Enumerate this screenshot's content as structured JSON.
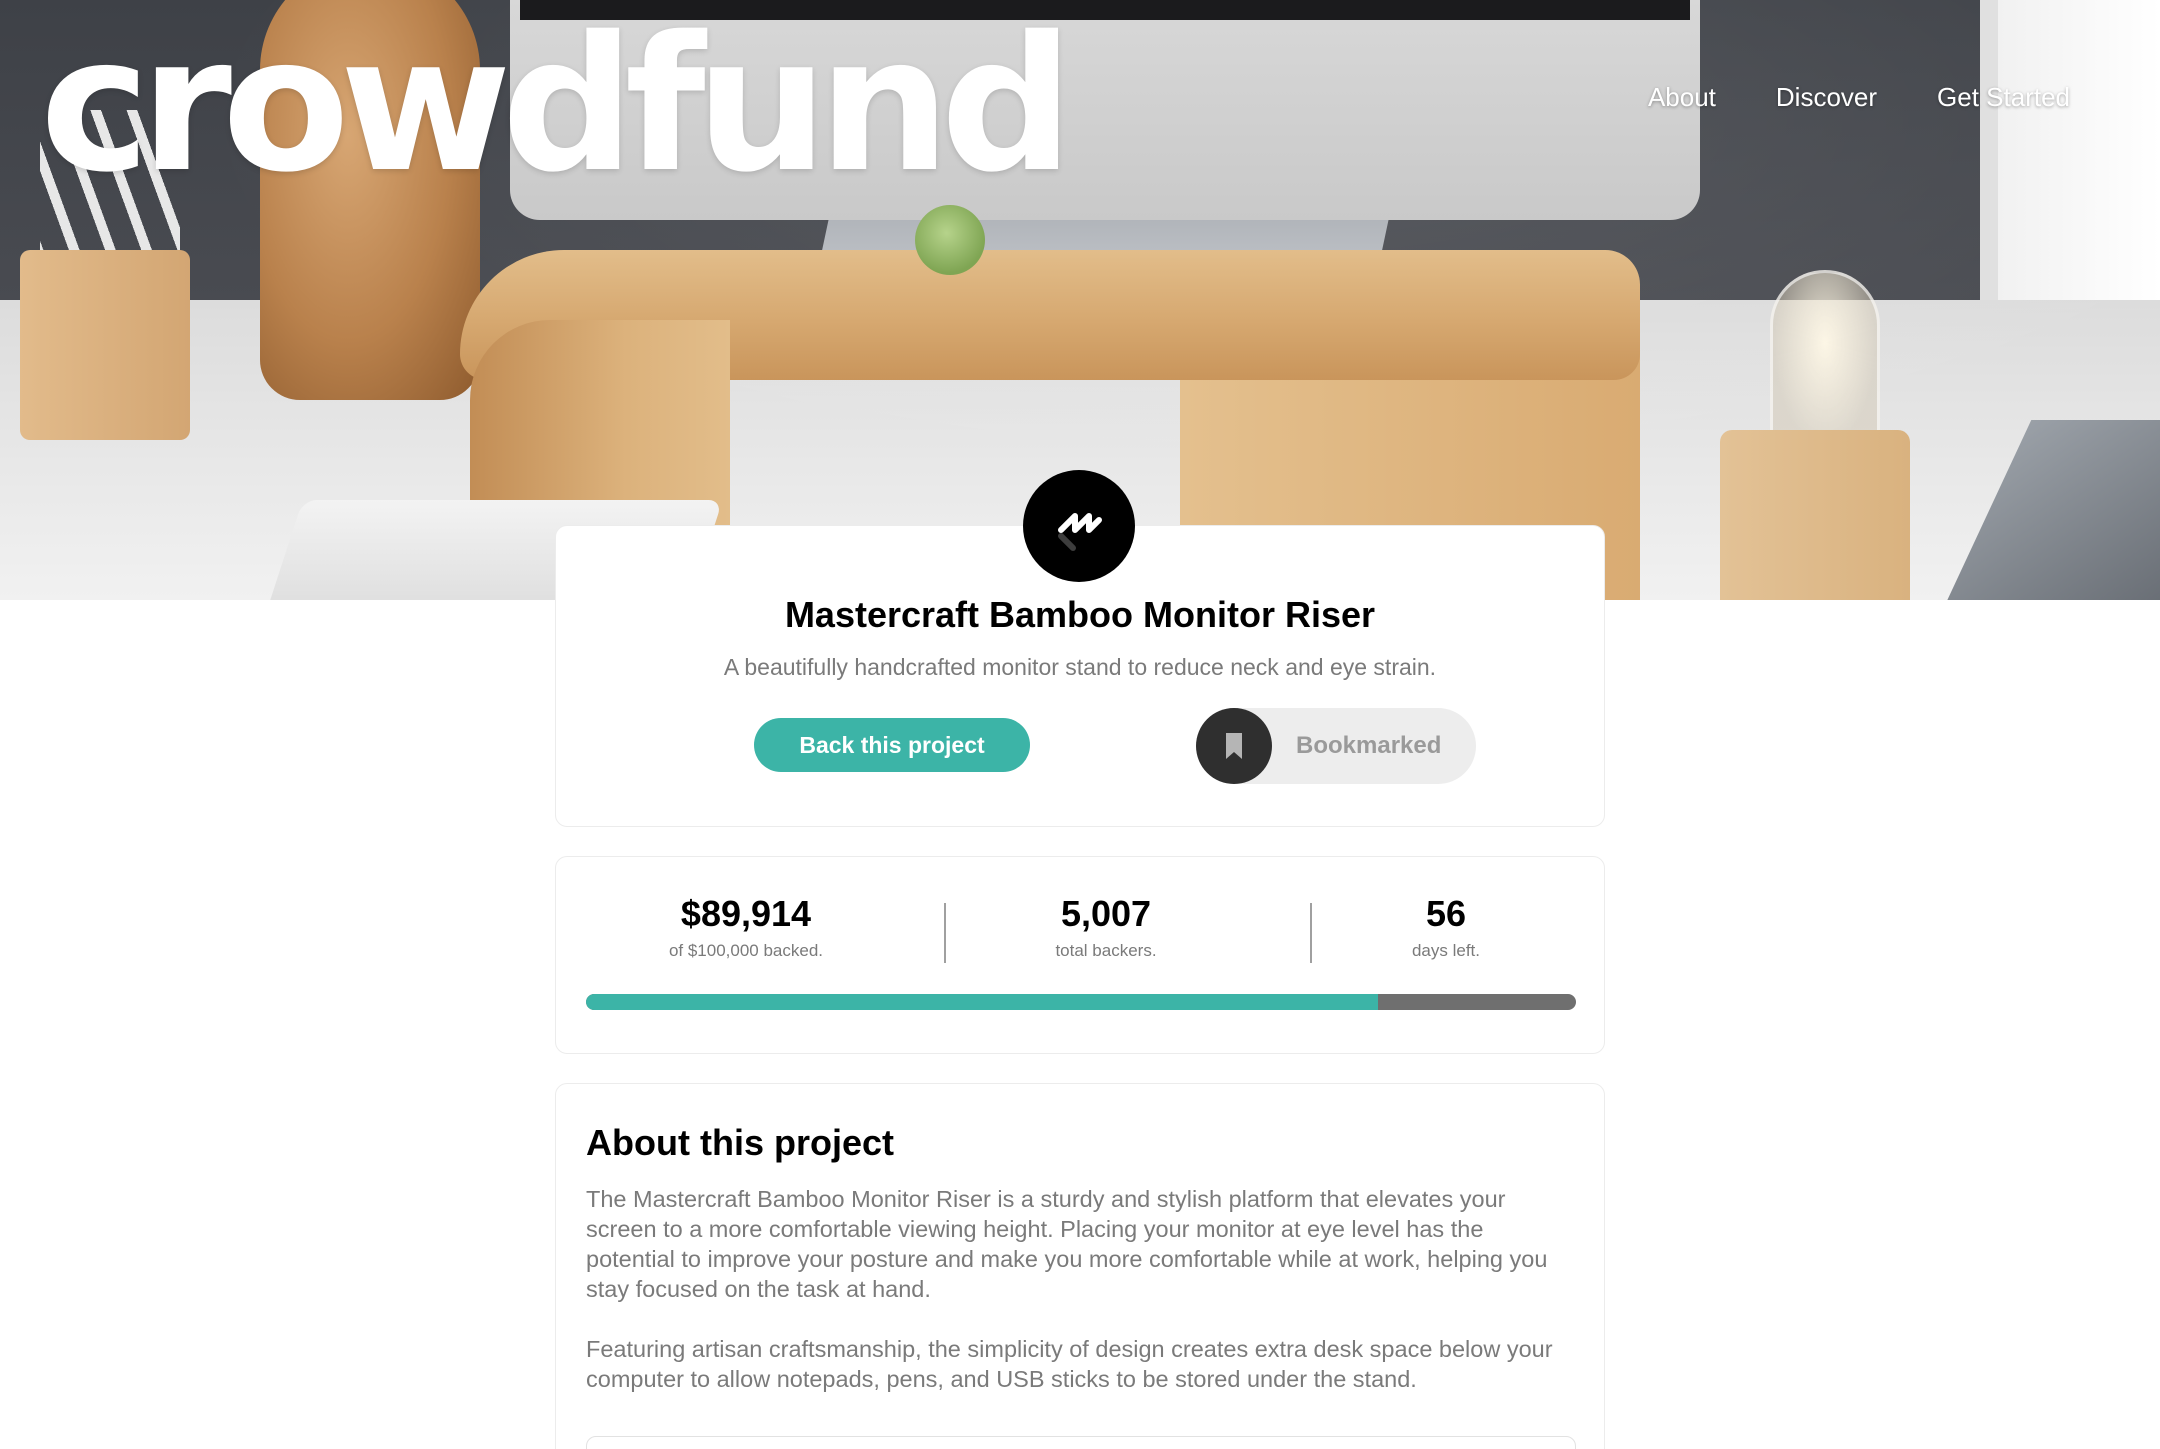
{
  "brand": {
    "name": "crowdfund"
  },
  "nav": {
    "items": [
      "About",
      "Discover",
      "Get Started"
    ]
  },
  "project": {
    "title": "Mastercraft Bamboo Monitor Riser",
    "description": "A beautifully handcrafted monitor stand to reduce neck and eye strain.",
    "back_button": "Back this project",
    "bookmark_button": "Bookmarked",
    "bookmark_icon": "bookmark-icon",
    "logo_icon": "mastercraft-logo"
  },
  "stats": {
    "backed_amount": "$89,914",
    "backed_caption": "of $100,000 backed.",
    "backers": "5,007",
    "backers_caption": "total backers.",
    "days_left": "56",
    "days_caption": "days left.",
    "progress_fraction": 0.8
  },
  "about": {
    "title": "About this project",
    "paragraphs": [
      "The Mastercraft Bamboo Monitor Riser is a sturdy and stylish platform that elevates your screen to a more comfortable viewing height. Placing your monitor at eye level has the potential to improve your posture and make you more comfortable while at work, helping you stay focused on the task at hand.",
      "Featuring artisan craftsmanship, the simplicity of design creates extra desk space below your computer to allow notepads, pens, and USB sticks to be stored under the stand."
    ]
  },
  "colors": {
    "accent": "#3cb4a7",
    "progress_track": "#6f6f6f",
    "dark": "#000000",
    "muted_text": "#7a7a7a"
  }
}
